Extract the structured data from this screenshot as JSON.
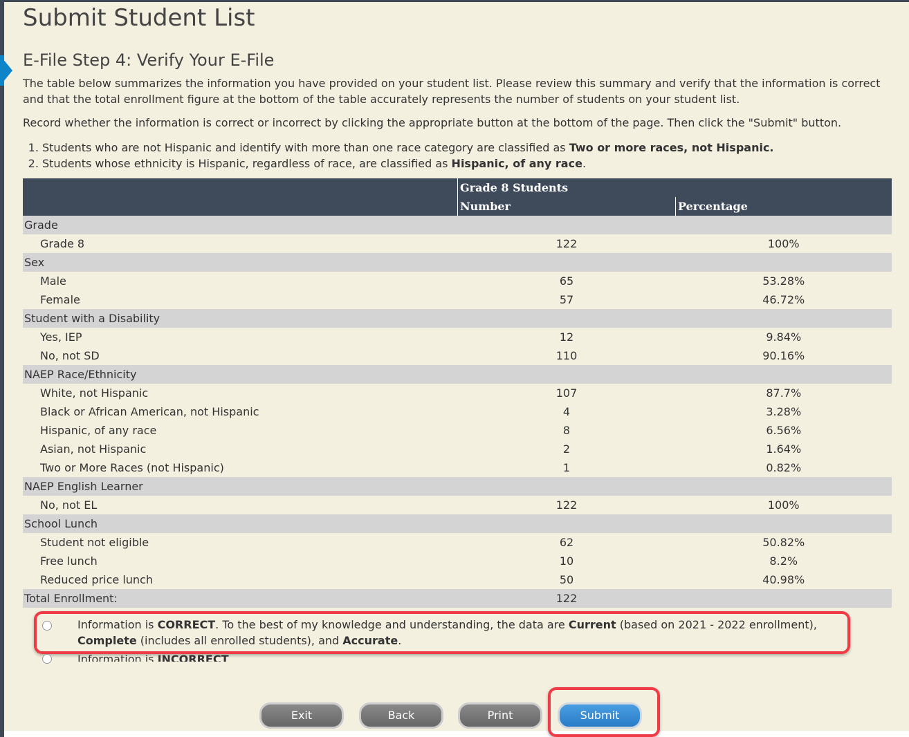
{
  "title": "Submit Student List",
  "step_title": "E-File Step 4: Verify Your E-File",
  "intro": "The table below summarizes the information you have provided on your student list. Please review this summary and verify that the information is correct and that the total enrollment figure at the bottom of the table accurately represents the number of students on your student list.",
  "instruction": "Record whether the information is correct or incorrect by clicking the appropriate button at the bottom of the page. Then click the \"Submit\" button.",
  "notes": [
    {
      "text": "Students who are not Hispanic and identify with more than one race category are classified as ",
      "bold": "Two or more races, not Hispanic.",
      "after": ""
    },
    {
      "text": "Students whose ethnicity is Hispanic, regardless of race, are classified as ",
      "bold": "Hispanic, of any race",
      "after": "."
    }
  ],
  "table": {
    "group_header": "Grade 8 Students",
    "col_number": "Number",
    "col_percentage": "Percentage",
    "sections": [
      {
        "label": "Grade",
        "rows": [
          [
            "Grade 8",
            "122",
            "100%"
          ]
        ]
      },
      {
        "label": "Sex",
        "rows": [
          [
            "Male",
            "65",
            "53.28%"
          ],
          [
            "Female",
            "57",
            "46.72%"
          ]
        ]
      },
      {
        "label": "Student with a Disability",
        "rows": [
          [
            "Yes, IEP",
            "12",
            "9.84%"
          ],
          [
            "No, not SD",
            "110",
            "90.16%"
          ]
        ]
      },
      {
        "label": "NAEP Race/Ethnicity",
        "rows": [
          [
            "White, not Hispanic",
            "107",
            "87.7%"
          ],
          [
            "Black or African American, not Hispanic",
            "4",
            "3.28%"
          ],
          [
            "Hispanic, of any race",
            "8",
            "6.56%"
          ],
          [
            "Asian, not Hispanic",
            "2",
            "1.64%"
          ],
          [
            "Two or More Races (not Hispanic)",
            "1",
            "0.82%"
          ]
        ]
      },
      {
        "label": "NAEP English Learner",
        "rows": [
          [
            "No, not EL",
            "122",
            "100%"
          ]
        ]
      },
      {
        "label": "School Lunch",
        "rows": [
          [
            "Student not eligible",
            "62",
            "50.82%"
          ],
          [
            "Free lunch",
            "10",
            "8.2%"
          ],
          [
            "Reduced price lunch",
            "50",
            "40.98%"
          ]
        ]
      }
    ],
    "total_label": "Total Enrollment:",
    "total_value": "122"
  },
  "options": {
    "correct": {
      "p1": "Information is ",
      "b1": "CORRECT",
      "p2": ". To the best of my knowledge and understanding, the data are ",
      "b2": "Current",
      "p3": " (based on 2021 - 2022 enrollment), ",
      "b3": "Complete",
      "p4": " (includes all enrolled students), and ",
      "b4": "Accurate",
      "p5": "."
    },
    "incorrect": {
      "p1": "Information is ",
      "b1": "INCORRECT",
      "p2": "."
    }
  },
  "buttons": {
    "exit": "Exit",
    "back": "Back",
    "print": "Print",
    "submit": "Submit"
  },
  "colors": {
    "background": "#f4f0e0",
    "header": "#3f4b5b",
    "section_row": "#d4d4d4",
    "primary_button": "#2a7cc8",
    "highlight": "#ee3b45"
  }
}
